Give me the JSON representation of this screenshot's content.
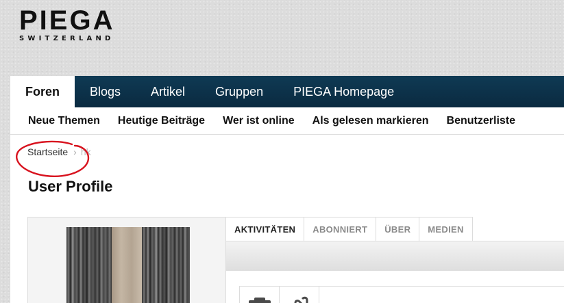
{
  "logo": {
    "word": "PIEGA",
    "tagline": "SWITZERLAND"
  },
  "nav_primary": [
    {
      "label": "Foren",
      "active": true
    },
    {
      "label": "Blogs"
    },
    {
      "label": "Artikel"
    },
    {
      "label": "Gruppen"
    },
    {
      "label": "PIEGA Homepage"
    }
  ],
  "nav_secondary": [
    {
      "label": "Neue Themen"
    },
    {
      "label": "Heutige Beiträge"
    },
    {
      "label": "Wer ist online"
    },
    {
      "label": "Als gelesen markieren"
    },
    {
      "label": "Benutzerliste"
    }
  ],
  "breadcrumb": {
    "home": "Startseite",
    "current": "hk"
  },
  "page_title": "User Profile",
  "profile_tabs": [
    {
      "label": "AKTIVITÄTEN",
      "active": true
    },
    {
      "label": "ABONNIERT"
    },
    {
      "label": "ÜBER"
    },
    {
      "label": "MEDIEN"
    }
  ],
  "colors": {
    "nav_bg": "#0f3a54",
    "annotation": "#d8121e",
    "panel_bg": "#ffffff"
  },
  "icons": [
    "chevron-right-icon",
    "camera-icon",
    "link-icon"
  ]
}
